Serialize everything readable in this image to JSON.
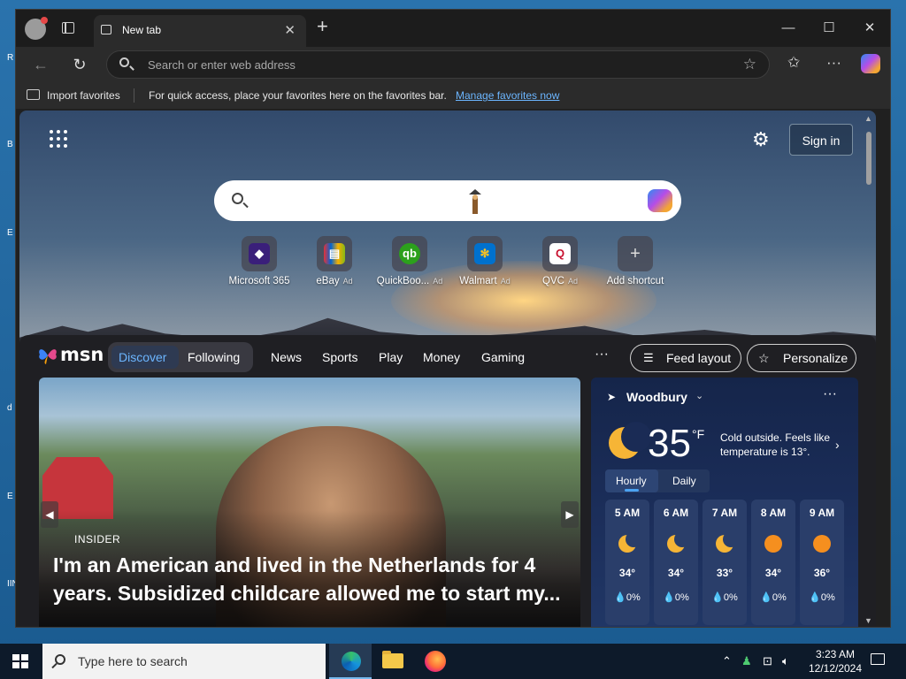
{
  "desktop": {
    "edge_letters": [
      "R",
      "B",
      "E",
      "d",
      "E",
      "IIN"
    ]
  },
  "browser": {
    "tab": {
      "title": "New tab",
      "close": "✕"
    },
    "new_tab": "+",
    "window_controls": {
      "minimize": "—",
      "maximize": "☐",
      "close": "✕"
    },
    "address_bar": {
      "placeholder": "Search or enter web address"
    },
    "favorites_bar": {
      "import_label": "Import favorites",
      "message": "For quick access, place your favorites here on the favorites bar.",
      "manage_link": "Manage favorites now"
    }
  },
  "newtab": {
    "sign_in": "Sign in",
    "shortcuts": [
      {
        "label": "Microsoft 365",
        "ad": "",
        "color": "#3a1f7a",
        "glyph": "◆"
      },
      {
        "label": "eBay",
        "ad": "Ad",
        "color": "#333333",
        "glyph": "▤"
      },
      {
        "label": "QuickBoo...",
        "ad": "Ad",
        "color": "#2ca01c",
        "glyph": "qb"
      },
      {
        "label": "Walmart",
        "ad": "Ad",
        "color": "#0071ce",
        "glyph": "✻"
      },
      {
        "label": "QVC",
        "ad": "Ad",
        "color": "#ffffff",
        "glyph": "Q"
      },
      {
        "label": "Add shortcut",
        "ad": "",
        "color": "#555555",
        "glyph": "+"
      }
    ]
  },
  "feed": {
    "logo_text": "msn",
    "tabs": {
      "discover": "Discover",
      "following": "Following"
    },
    "nav": [
      "News",
      "Sports",
      "Play",
      "Money",
      "Gaming"
    ],
    "more": "···",
    "feed_layout": "Feed layout",
    "personalize": "Personalize",
    "hero": {
      "source": "INSIDER",
      "title": "I'm an American and lived in the Netherlands for 4 years. Subsidized childcare allowed me to start my..."
    }
  },
  "weather": {
    "location": "Woodbury",
    "temp": "35",
    "unit": "°F",
    "description": "Cold outside. Feels like temperature is 13°.",
    "tabs": {
      "hourly": "Hourly",
      "daily": "Daily"
    },
    "hours": [
      {
        "time": "5 AM",
        "icon": "moon-icon",
        "temp": "34°",
        "precip": "0%"
      },
      {
        "time": "6 AM",
        "icon": "moon-icon",
        "temp": "34°",
        "precip": "0%"
      },
      {
        "time": "7 AM",
        "icon": "moon-icon",
        "temp": "33°",
        "precip": "0%"
      },
      {
        "time": "8 AM",
        "icon": "sun-icon",
        "temp": "34°",
        "precip": "0%"
      },
      {
        "time": "9 AM",
        "icon": "sun-icon",
        "temp": "36°",
        "precip": "0%"
      }
    ]
  },
  "taskbar": {
    "search_placeholder": "Type here to search",
    "time": "3:23 AM",
    "date": "12/12/2024"
  }
}
